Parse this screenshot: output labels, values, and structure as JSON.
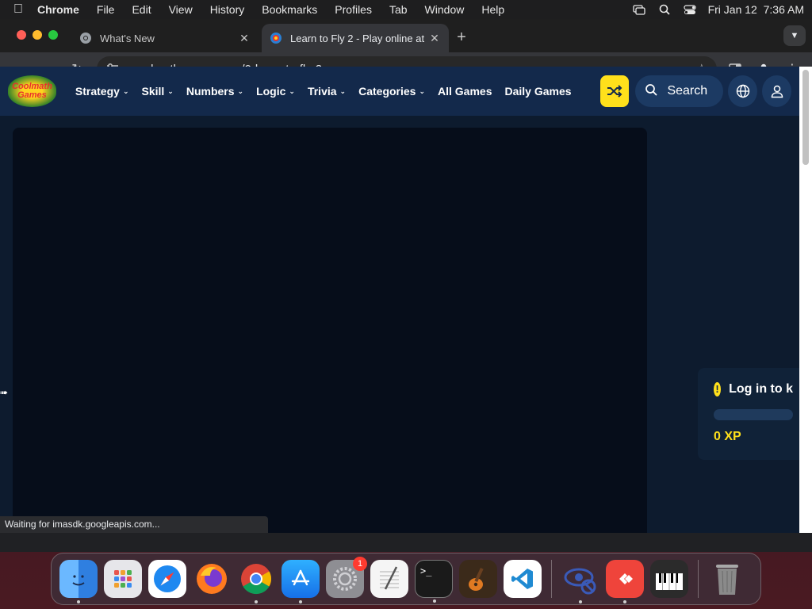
{
  "menubar": {
    "app_name": "Chrome",
    "items": [
      "File",
      "Edit",
      "View",
      "History",
      "Bookmarks",
      "Profiles",
      "Tab",
      "Window",
      "Help"
    ],
    "datetime": "Fri Jan 12  7:36 AM"
  },
  "tabs": [
    {
      "title": "What's New",
      "active": false
    },
    {
      "title": "Learn to Fly 2 - Play online at",
      "active": true
    }
  ],
  "toolbar": {
    "url": "coolmathgames.com/0-learn-to-fly-2"
  },
  "site": {
    "logo": {
      "line1": "Coolmath",
      "line2": "Games"
    },
    "nav": [
      {
        "label": "Strategy",
        "has_dropdown": true
      },
      {
        "label": "Skill",
        "has_dropdown": true
      },
      {
        "label": "Numbers",
        "has_dropdown": true
      },
      {
        "label": "Logic",
        "has_dropdown": true
      },
      {
        "label": "Trivia",
        "has_dropdown": true
      },
      {
        "label": "Categories",
        "has_dropdown": true
      },
      {
        "label": "All Games",
        "has_dropdown": false
      },
      {
        "label": "Daily Games",
        "has_dropdown": false
      }
    ],
    "search_label": "Search",
    "xp_card": {
      "heading": "Log in to k",
      "xp": "0 XP",
      "warn_glyph": "!"
    },
    "colors": {
      "nav_bg": "#13294b",
      "accent": "#ffe01b",
      "page_bg": "#0d1b2e"
    }
  },
  "status_text": "Waiting for imasdk.googleapis.com...",
  "dock": {
    "apps": [
      {
        "name": "finder-icon",
        "color": "#3a8cf0"
      },
      {
        "name": "launchpad-icon",
        "color": "#e0e0e0"
      },
      {
        "name": "safari-icon",
        "color": "#2f8ff0"
      },
      {
        "name": "firefox-icon",
        "color": "#ff7a1f"
      },
      {
        "name": "chrome-icon",
        "color": "#ffffff"
      },
      {
        "name": "app-store-icon",
        "color": "#1e8cf5"
      },
      {
        "name": "system-settings-icon",
        "color": "#8e8e93",
        "badge": "1"
      },
      {
        "name": "textedit-icon",
        "color": "#f5f5f5"
      },
      {
        "name": "terminal-icon",
        "color": "#1a1a1a"
      },
      {
        "name": "garageband-icon",
        "color": "#3b2a1a"
      },
      {
        "name": "vscode-icon",
        "color": "#ffffff"
      },
      {
        "name": "privacy-eye-icon",
        "color": "#2a3a7a"
      },
      {
        "name": "anydesk-icon",
        "color": "#ef443b"
      },
      {
        "name": "piano-icon",
        "color": "#2b2b2b"
      },
      {
        "name": "trash-icon",
        "color": "#9a9a9a"
      }
    ]
  }
}
